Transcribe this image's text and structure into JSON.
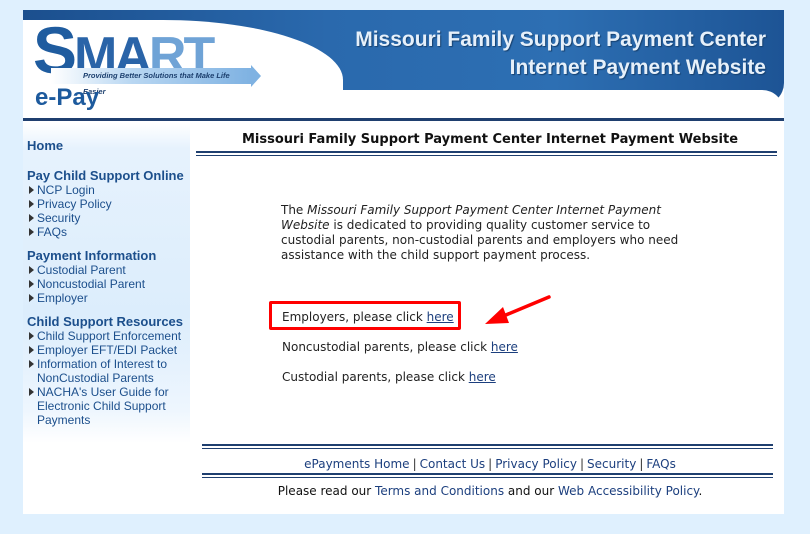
{
  "banner": {
    "logo_main": "SMART",
    "logo_tagline": "Providing Better Solutions that Make Life Easier",
    "logo_sub": "e-Pay",
    "title_line1": "Missouri Family Support Payment Center",
    "title_line2": "Internet Payment Website"
  },
  "sidebar": {
    "home": "Home",
    "sections": [
      {
        "title": "Pay Child Support Online",
        "items": [
          "NCP Login",
          "Privacy Policy",
          "Security",
          "FAQs"
        ]
      },
      {
        "title": "Payment Information",
        "items": [
          "Custodial Parent",
          "Noncustodial Parent",
          "Employer"
        ]
      },
      {
        "title": "Child Support Resources",
        "items": [
          "Child Support Enforcement",
          "Employer EFT/EDI Packet",
          "Information of Interest to NonCustodial Parents",
          "NACHA's User Guide for Electronic Child Support Payments"
        ]
      }
    ]
  },
  "main": {
    "title": "Missouri Family Support Payment Center Internet Payment Website",
    "intro_prefix": "The ",
    "intro_italic": "Missouri Family Support Payment Center Internet Payment Website",
    "intro_suffix": " is dedicated to providing quality customer service to custodial parents, non-custodial parents and employers who need assistance with the child support payment process.",
    "links": [
      {
        "text": "Employers, please click ",
        "link": "here"
      },
      {
        "text": "Noncustodial parents, please click ",
        "link": "here"
      },
      {
        "text": "Custodial parents, please click ",
        "link": "here"
      }
    ]
  },
  "footer": {
    "links": [
      "ePayments Home",
      "Contact Us",
      "Privacy Policy",
      "Security",
      "FAQs"
    ],
    "separator": "|",
    "note_prefix": "Please read our ",
    "terms": "Terms and Conditions",
    "note_middle": " and our ",
    "accessibility": "Web Accessibility Policy",
    "note_suffix": "."
  },
  "annotation": {
    "highlight_color": "#ff0000"
  }
}
